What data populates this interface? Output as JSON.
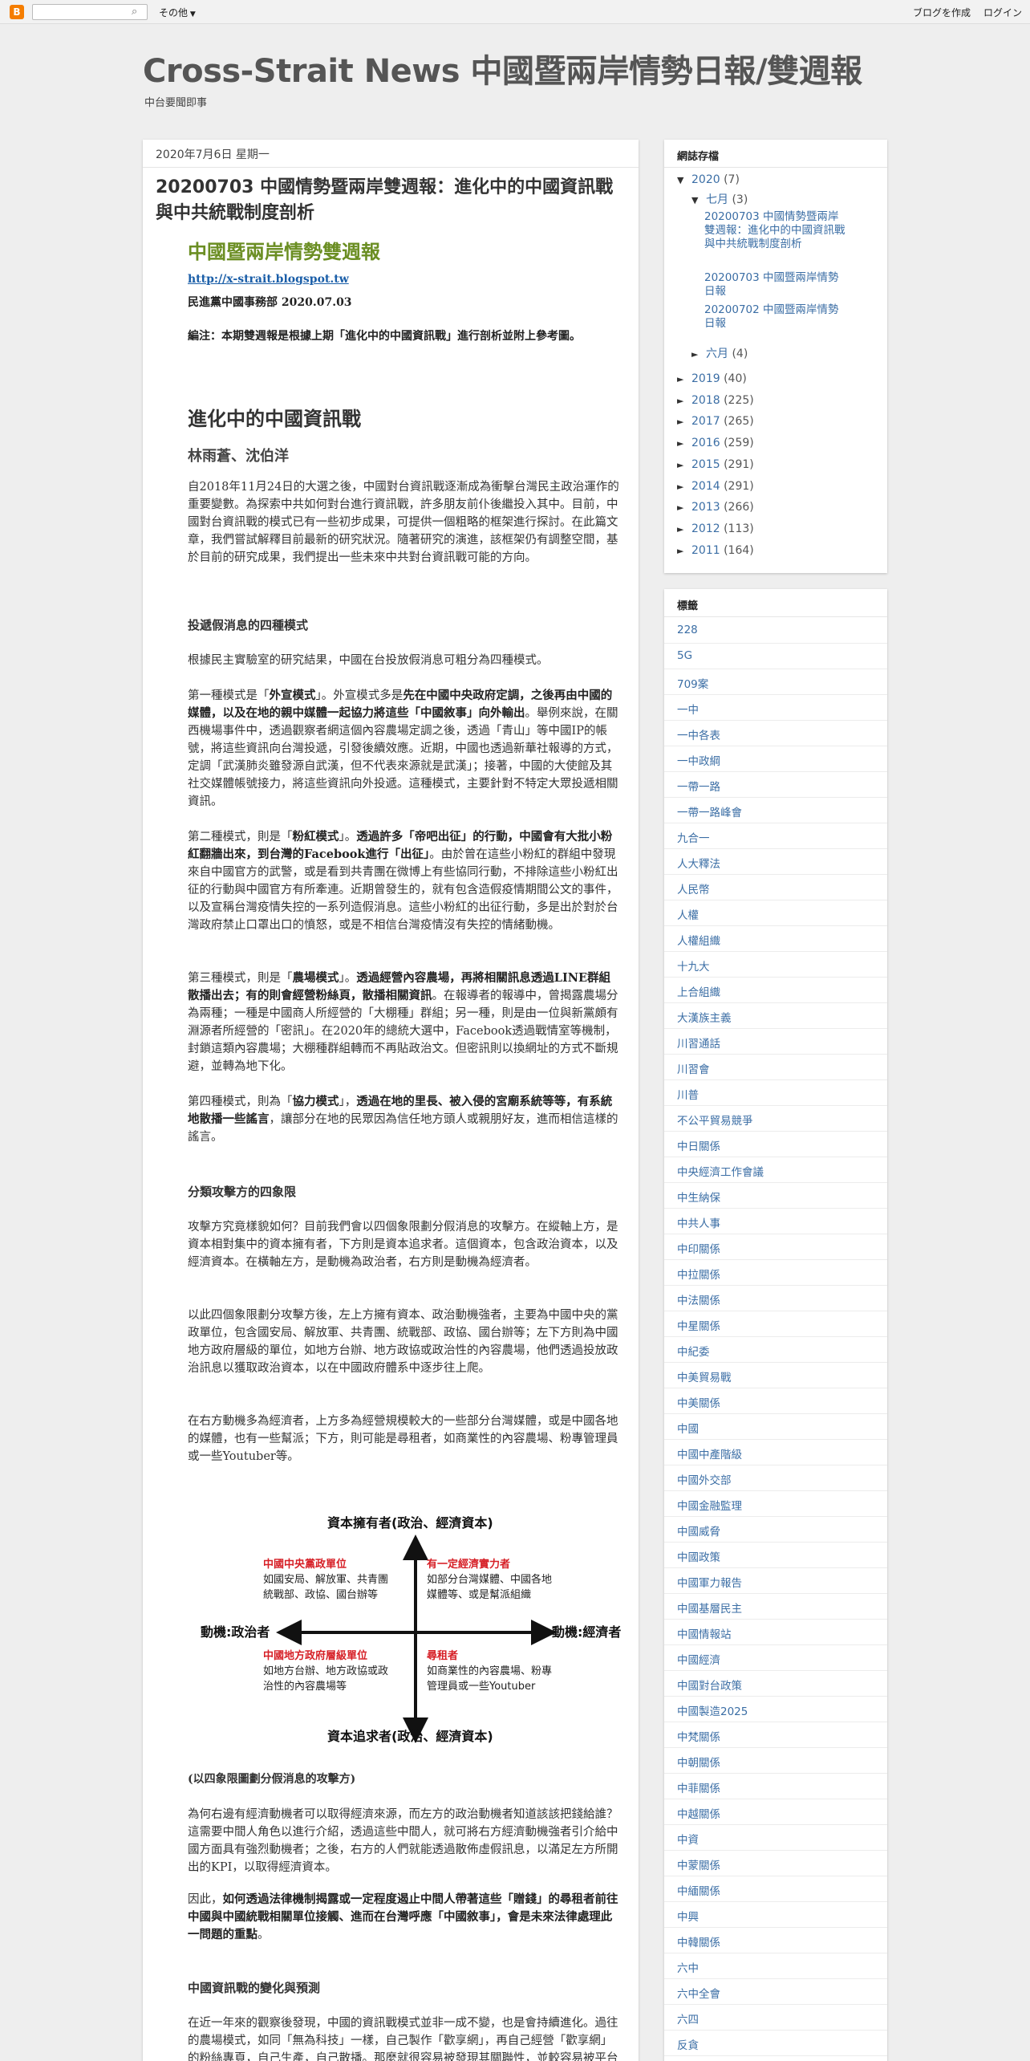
{
  "navbar": {
    "logo": "B",
    "search_placeholder": "",
    "search_icon": "magnifier-icon",
    "more_label": "その他",
    "create_blog": "ブログを作成",
    "login": "ログイン"
  },
  "header": {
    "title": "Cross-Strait News 中國暨兩岸情勢日報/雙週報",
    "description": "中台要聞即事"
  },
  "post": {
    "date": "2020年7月6日 星期一",
    "title": "20200703 中國情勢暨兩岸雙週報：進化中的中國資訊戰與中共統戰制度剖析",
    "report_heading": "中國暨兩岸情勢雙週報",
    "link": "http://x-strait.blogspot.tw",
    "org_date": "民進黨中國事務部 2020.07.03",
    "editor_note": "編注：本期雙週報是根據上期「進化中的中國資訊戰」進行剖析並附上參考圖。",
    "article_title": "進化中的中國資訊戰",
    "authors": "林雨蒼、沈伯洋",
    "p1": "自2018年11月24日的大選之後，中國對台資訊戰逐漸成為衝擊台灣民主政治運作的重要變數。為探索中共如何對台進行資訊戰，許多朋友前仆後繼投入其中。目前，中國對台資訊戰的模式已有一些初步成果，可提供一個粗略的框架進行探討。在此篇文章，我們嘗試解釋目前最新的研究狀況。隨著研究的演進，該框架仍有調整空間，基於目前的研究成果，我們提出一些未來中共對台資訊戰可能的方向。",
    "s1_title": "投遞假消息的四種模式",
    "s1_p0": "根據民主實驗室的研究結果，中國在台投放假消息可粗分為四種模式。",
    "m1_a": "第一種模式是「",
    "m1_b": "外宣模式",
    "m1_c": "」。外宣模式多是",
    "m1_d": "先在中國中央政府定調，之後再由中國的媒體，以及在地的親中媒體一起協力將這些「中國敘事」向外輸出",
    "m1_e": "。舉例來說，在關西機場事件中，透過觀察者網這個內容農場定調之後，透過「青山」等中國IP的帳號，將這些資訊向台灣投遞，引發後續效應。近期，中國也透過新華社報導的方式，定調「武漢肺炎雖發源自武漢，但不代表來源就是武漢」；接著，中國的大使館及其社交媒體帳號接力，將這些資訊向外投遞。這種模式，主要針對不特定大眾投遞相關資訊。",
    "m2_a": "第二種模式，則是「",
    "m2_b": "粉紅模式",
    "m2_c": "」。",
    "m2_d": "透過許多「帝吧出征」的行動，中國會有大批小粉紅翻牆出來，到台灣的Facebook進行「出征」",
    "m2_e": "。由於曾在這些小粉紅的群組中發現來自中國官方的武警，或是看到共青團在微博上有些協同行動，不排除這些小粉紅出征的行動與中國官方有所牽連。近期曾發生的，就有包含造假疫情期間公文的事件，以及宣稱台灣疫情失控的一系列造假消息。這些小粉紅的出征行動，多是出於對於台灣政府禁止口罩出口的憤怒，或是不相信台灣疫情沒有失控的情緒動機。",
    "m3_a": "第三種模式，則是「",
    "m3_b": "農場模式",
    "m3_c": "」。",
    "m3_d": "透過經營內容農場，再將相關訊息透過LINE群組散播出去；有的則會經營粉絲頁，散播相關資訊",
    "m3_e": "。在報導者的報導中，曾揭露農場分為兩種；一種是中國商人所經營的「大棚種」群組；另一種，則是由一位與新黨頗有淵源者所經營的「密訊」。在2020年的總統大選中，Facebook透過戰情室等機制，封鎖這類內容農場；大棚種群組轉而不再貼政治文。但密訊則以換網址的方式不斷規避，並轉為地下化。",
    "m4_a": "第四種模式，則為「",
    "m4_b": "協力模式",
    "m4_c": "」，",
    "m4_d": "透過在地的里長、被入侵的宮廟系統等等，有系統地散播一些謠言",
    "m4_e": "，讓部分在地的民眾因為信任地方頭人或親朋好友，進而相信這樣的謠言。",
    "s2_title": "分類攻擊方的四象限",
    "s2_p1": "攻擊方究竟樣貌如何？目前我們會以四個象限劃分假消息的攻擊方。在縱軸上方，是資本相對集中的資本擁有者，下方則是資本追求者。這個資本，包含政治資本，以及經濟資本。在橫軸左方，是動機為政治者，右方則是動機為經濟者。",
    "s2_p2": "以此四個象限劃分攻擊方後，左上方擁有資本、政治動機強者，主要為中國中央的黨政單位，包含國安局、解放軍、共青團、統戰部、政協、國台辦等；左下方則為中國地方政府層級的單位，如地方台辦、地方政協或政治性的內容農場，他們透過投放政治訊息以獲取政治資本，以在中國政府體系中逐步往上爬。",
    "s2_p3": "在右方動機多為經濟者，上方多為經營規模較大的一些部分台灣媒體，或是中國各地的媒體，也有一些幫派；下方，則可能是尋租者，如商業性的內容農場、粉專管理員或一些Youtuber等。",
    "diagram": {
      "top": "資本擁有者(政治、經濟資本)",
      "bottom": "資本追求者(政治、經濟資本)",
      "left": "動機:政治者",
      "right": "動機:經濟者",
      "tl_title": "中國中央黨政單位",
      "tl_l1": "如國安局、解放軍、共青團",
      "tl_l2": "統戰部、政協、國台辦等",
      "tr_title": "有一定經濟實力者",
      "tr_l1": "如部分台灣媒體、中國各地",
      "tr_l2": "媒體等、或是幫派組織",
      "bl_title": "中國地方政府層級單位",
      "bl_l1": "如地方台辦、地方政協或政",
      "bl_l2": "治性的內容農場等",
      "br_title": "尋租者",
      "br_l1": "如商業性的內容農場、粉專",
      "br_l2": "管理員或一些Youtuber"
    },
    "caption": "(以四象限圖劃分假消息的攻擊方)",
    "s2_p4": "為何右邊有經濟動機者可以取得經濟來源，而左方的政治動機者知道該該把錢給誰？這需要中間人角色以進行介紹，透過這些中間人，就可將右方經濟動機強者引介給中國方面具有強烈動機者；之後，右方的人們就能透過散佈虛假訊息，以滿足左方所開出的KPI，以取得經濟資本。",
    "s2_p5_a": "因此，",
    "s2_p5_b": "如何透過法律機制揭露或一定程度遏止中間人帶著這些「贈錢」的尋租者前往中國與中國統戰相關單位接觸、進而在台灣呼應「中國敘事」，會是未來法律處理此一問題的重點",
    "s2_p5_c": "。",
    "s3_title": "中國資訊戰的變化與預測",
    "s3_p1": "在近一年來的觀察後發現，中國的資訊戰模式並非一成不變，也是會持續進化。過往的農場模式，如同「無為科技」一樣，自己製作「歡享網」，再自己經營「歡享網」的粉絲專頁，自己生產，自己散播。那麼就很容易被發現其關聯性，並較容易被平台封鎖。"
  },
  "archive": {
    "title": "網誌存檔",
    "y2020": "2020",
    "y2020_count": "(7)",
    "july": "七月",
    "july_count": "(3)",
    "posts": [
      "20200703 中國情勢暨兩岸雙週報：進化中的中國資訊戰與中共統戰制度剖析",
      "20200703 中國暨兩岸情勢日報",
      "20200702 中國暨兩岸情勢日報"
    ],
    "june": "六月",
    "june_count": "(4)",
    "years": [
      {
        "year": "2019",
        "count": "(40)"
      },
      {
        "year": "2018",
        "count": "(225)"
      },
      {
        "year": "2017",
        "count": "(265)"
      },
      {
        "year": "2016",
        "count": "(259)"
      },
      {
        "year": "2015",
        "count": "(291)"
      },
      {
        "year": "2014",
        "count": "(291)"
      },
      {
        "year": "2013",
        "count": "(266)"
      },
      {
        "year": "2012",
        "count": "(113)"
      },
      {
        "year": "2011",
        "count": "(164)"
      }
    ]
  },
  "labels": {
    "title": "標籤",
    "items": [
      "228",
      "5G",
      "709案",
      "一中",
      "一中各表",
      "一中政綱",
      "一帶一路",
      "一帶一路峰會",
      "九合一",
      "人大釋法",
      "人民幣",
      "人權",
      "人權組織",
      "十九大",
      "上合組織",
      "大漢族主義",
      "川習通話",
      "川習會",
      "川普",
      "不公平貿易競爭",
      "中日關係",
      "中央經濟工作會議",
      "中生納保",
      "中共人事",
      "中印關係",
      "中拉關係",
      "中法關係",
      "中星關係",
      "中紀委",
      "中美貿易戰",
      "中美關係",
      "中國",
      "中國中產階級",
      "中國外交部",
      "中國金融監理",
      "中國威脅",
      "中國政策",
      "中國軍力報告",
      "中國基層民主",
      "中國情報站",
      "中國經濟",
      "中國對台政策",
      "中國製造2025",
      "中梵關係",
      "中朝關係",
      "中菲關係",
      "中越關係",
      "中資",
      "中蒙關係",
      "中緬關係",
      "中興",
      "中韓關係",
      "六中",
      "六中全會",
      "六四",
      "反貪"
    ]
  }
}
